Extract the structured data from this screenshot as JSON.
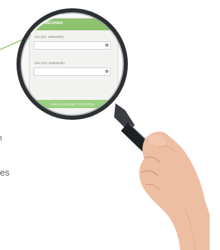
{
  "widget": {
    "title": "TARIFRECHNER",
    "from_label": "Von (Ort, Haltestelle)",
    "to_label": "Zum (Ort, Haltestelle)",
    "from_value": "",
    "to_value": "",
    "submit_label": "TARIFAUSKUNFT STARTEN"
  },
  "background_text": {
    "fragment_a": "t",
    "fragment_b": "es"
  },
  "colors": {
    "accent_green": "#8dc26f",
    "button_green": "#9ccf82",
    "lens_rim": "#2e3134",
    "skin": "#eebea3"
  }
}
